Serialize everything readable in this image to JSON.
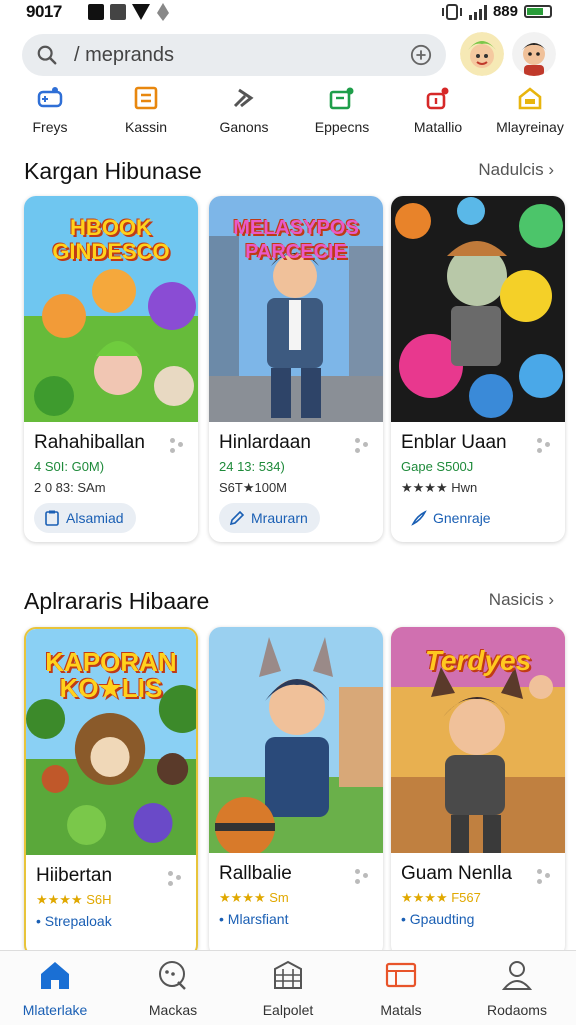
{
  "status": {
    "time": "9017",
    "battery": "889"
  },
  "search": {
    "text": "/ meprands"
  },
  "categories": [
    {
      "label": "Freys",
      "icon": "controller-icon",
      "color": "#2f6fd6"
    },
    {
      "label": "Kassin",
      "icon": "box-icon",
      "color": "#e8870e"
    },
    {
      "label": "Ganons",
      "icon": "arrow-icon",
      "color": "#555555"
    },
    {
      "label": "Eppecns",
      "icon": "gamepad-icon",
      "color": "#1e9e4a"
    },
    {
      "label": "Matallio",
      "icon": "joystick-icon",
      "color": "#d62828"
    },
    {
      "label": "Mlayreinay",
      "icon": "home-icon",
      "color": "#e8b50e"
    }
  ],
  "sections": [
    {
      "title": "Kargan Hibunase",
      "more": "Nadulcis",
      "cards": [
        {
          "title": "Rahahiballan",
          "meta1": "4 S0I: G0M)",
          "meta2": "2 0 83: SAm",
          "button": "Alsamiad",
          "banner": "HBOOK GINDESCO"
        },
        {
          "title": "Hinlardaan",
          "meta1": "24 13: 534)",
          "meta2": "S6T★100M",
          "button": "Mraurarn",
          "banner": "MELASYPOS PARCECIE"
        },
        {
          "title": "Enblar Uaan",
          "meta1": "Gape S500J",
          "meta2": "★★★★ Hwn",
          "button": "Gnenraje",
          "banner": ""
        }
      ]
    },
    {
      "title": "Aplrararis Hibaare",
      "more": "Nasicis",
      "cards": [
        {
          "title": "Hiibertan",
          "meta1": "★★★★ S6H",
          "meta2": "• Strepaloak",
          "banner": "KAPORAN KO★LIS"
        },
        {
          "title": "Rallbalie",
          "meta1": "★★★★ Sm",
          "meta2": "• Mlarsfiant",
          "banner": ""
        },
        {
          "title": "Guam Nenlla",
          "meta1": "★★★★ F567",
          "meta2": "• Gpaudting",
          "banner": "Terdyes"
        }
      ]
    }
  ],
  "nav": [
    {
      "label": "Mlaterlake",
      "icon": "home-icon",
      "active": true
    },
    {
      "label": "Mackas",
      "icon": "chat-icon",
      "active": false
    },
    {
      "label": "Ealpolet",
      "icon": "grid-icon",
      "active": false
    },
    {
      "label": "Matals",
      "icon": "window-icon",
      "active": false
    },
    {
      "label": "Rodaoms",
      "icon": "profile-icon",
      "active": false
    }
  ]
}
